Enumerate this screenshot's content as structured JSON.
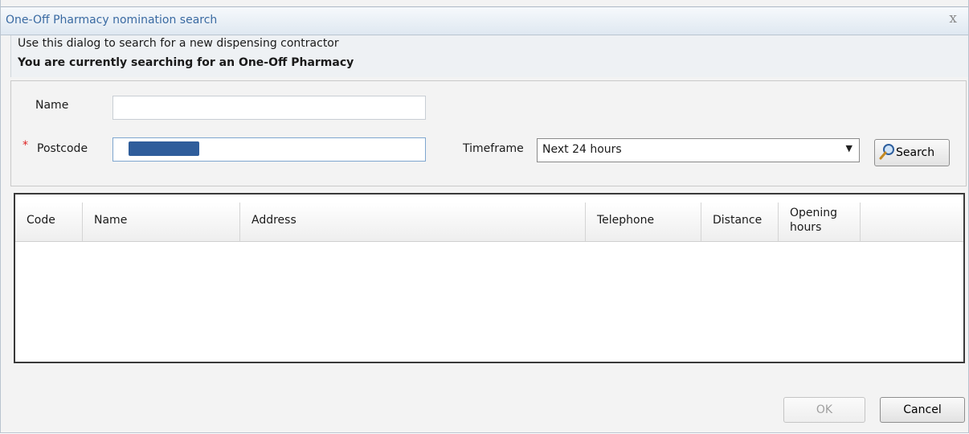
{
  "window": {
    "title": "One-Off Pharmacy nomination search",
    "close_symbol": "x"
  },
  "info": {
    "description": "Use this dialog to search for a new dispensing contractor",
    "mode": "You are currently searching for an One-Off Pharmacy"
  },
  "form": {
    "name_label": "Name",
    "name_value": "",
    "required_marker": "*",
    "postcode_label": "Postcode",
    "postcode_value": "",
    "timeframe_label": "Timeframe",
    "timeframe_value": "Next 24 hours",
    "search_button": "Search"
  },
  "results": {
    "columns": [
      "Code",
      "Name",
      "Address",
      "Telephone",
      "Distance",
      "Opening hours"
    ],
    "rows": []
  },
  "footer": {
    "ok_label": "OK",
    "ok_enabled": false,
    "cancel_label": "Cancel"
  },
  "colors": {
    "title_text": "#3a6aa2",
    "required": "#dd2222",
    "redaction": "#2f5d9b"
  }
}
